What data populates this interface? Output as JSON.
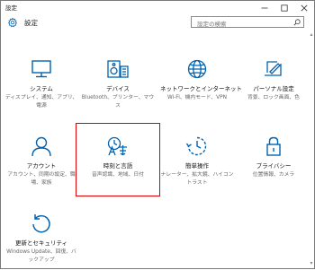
{
  "window": {
    "title": "設定"
  },
  "header": {
    "title": "設定"
  },
  "search": {
    "placeholder": "設定の検索"
  },
  "tiles": [
    {
      "label": "システム",
      "desc": "ディスプレイ、通知、アプリ、電源"
    },
    {
      "label": "デバイス",
      "desc": "Bluetooth、プリンター、マウス"
    },
    {
      "label": "ネットワークとインターネット",
      "desc": "Wi-Fi、機内モード、VPN"
    },
    {
      "label": "パーソナル設定",
      "desc": "背景、ロック画面、色"
    },
    {
      "label": "アカウント",
      "desc": "アカウント、同期の設定、職場、家族"
    },
    {
      "label": "時刻と言語",
      "desc": "音声認識、地域、日付"
    },
    {
      "label": "簡単操作",
      "desc": "ナレーター、拡大鏡、ハイコントラスト"
    },
    {
      "label": "プライバシー",
      "desc": "位置情報、カメラ"
    },
    {
      "label": "更新とセキュリティ",
      "desc": "Windows Update、回復、バックアップ"
    }
  ],
  "colors": {
    "accent": "#0063b1",
    "highlight": "#e00000"
  }
}
